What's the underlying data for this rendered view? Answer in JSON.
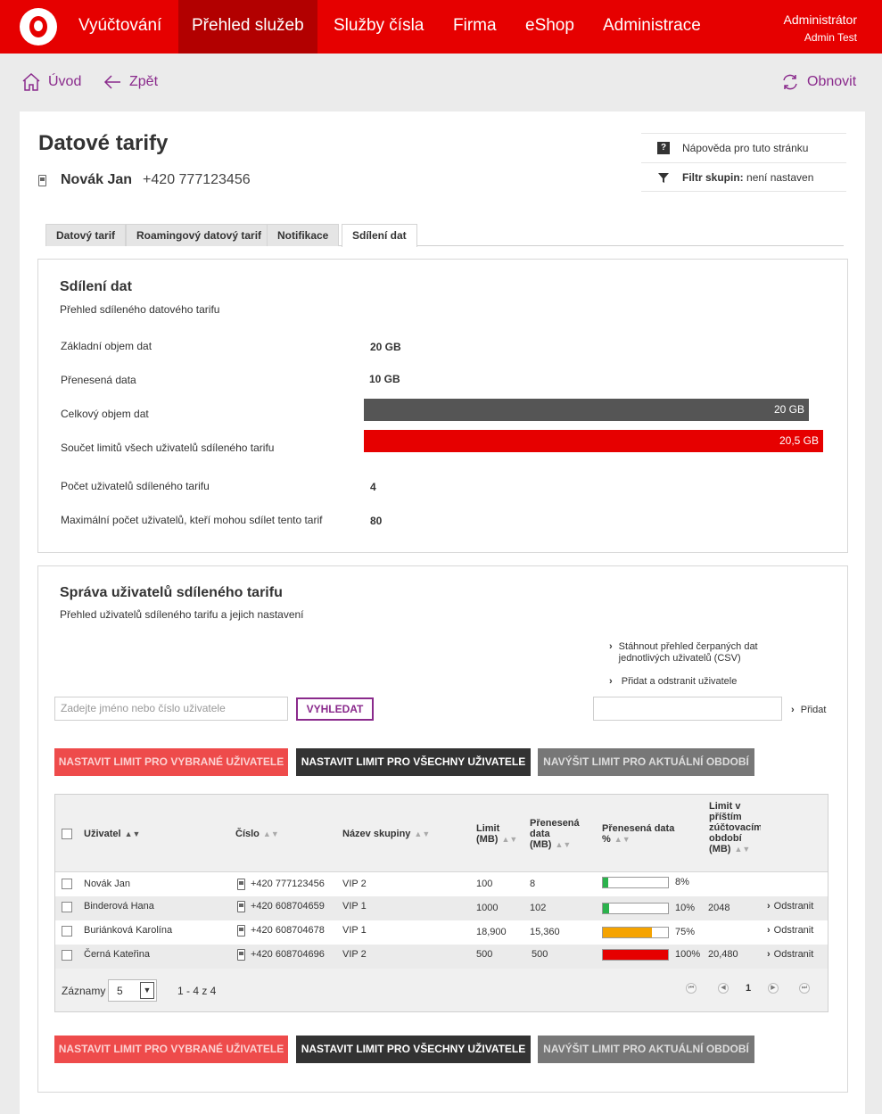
{
  "topnav": {
    "items": [
      "Vyúčtování",
      "Přehled služeb",
      "Služby čísla",
      "Firma",
      "eShop",
      "Administrace"
    ],
    "active_index": 1,
    "user_role": "Administrátor",
    "user_name": "Admin Test"
  },
  "toolbar": {
    "home_label": "Úvod",
    "back_label": "Zpět",
    "refresh_label": "Obnovit"
  },
  "page": {
    "title": "Datové tarify",
    "user_name": "Novák Jan",
    "user_number": "+420 777123456",
    "help_label": "Nápověda pro tuto stránku",
    "filter_label": "Filtr skupin:",
    "filter_value": "není nastaven"
  },
  "tabs": [
    "Datový tarif",
    "Roamingový datový tarif",
    "Notifikace",
    "Sdílení dat"
  ],
  "sharing": {
    "title": "Sdílení dat",
    "subtitle": "Přehled sdíleného datového tarifu",
    "base_label": "Základní objem dat",
    "base_value": "20 GB",
    "transferred_label": "Přenesená data",
    "transferred_value": "10 GB",
    "total_label": "Celkový objem dat",
    "total_value": "20 GB",
    "limits_label": "Součet limitů všech uživatelů sdíleného tarifu",
    "limits_value": "20,5 GB",
    "users_label": "Počet uživatelů sdíleného tarifu",
    "users_value": "4",
    "max_label": "Maximální počet uživatelů, kteří mohou sdílet tento tarif",
    "max_value": "80"
  },
  "users": {
    "title": "Správa uživatelů sdíleného tarifu",
    "subtitle": "Přehled uživatelů sdíleného tarifu a jejich nastavení",
    "download_link": "Stáhnout přehled čerpaných dat jednotlivých uživatelů (CSV)",
    "add_remove_link": "Přidat a odstranit uživatele",
    "search_placeholder": "Zadejte jméno nebo číslo uživatele",
    "search_button": "VYHLEDAT",
    "add_label": "Přidat",
    "btn_set_selected": "NASTAVIT LIMIT PRO VYBRANÉ UŽIVATELE",
    "btn_set_all": "NASTAVIT LIMIT PRO VŠECHNY UŽIVATELE",
    "btn_increase": "NAVÝŠIT LIMIT PRO AKTUÁLNÍ OBDOBÍ",
    "columns": {
      "user": "Uživatel",
      "number": "Číslo",
      "group": "Název skupiny",
      "limit": "Limit (MB)",
      "transferred": "Přenesená data (MB)",
      "transferred_pct": "Přenesená data %",
      "next_limit": "Limit v příštím zúčtovacím období (MB)"
    },
    "rows": [
      {
        "name": "Novák Jan",
        "number": "+420 777123456",
        "group": "VIP 2",
        "limit": "100",
        "transferred": "8",
        "pct": 8,
        "pct_label": "8%",
        "next": "",
        "action": "",
        "bar_color": "#2bb24c"
      },
      {
        "name": "Binderová Hana",
        "number": "+420 608704659",
        "group": "VIP 1",
        "limit": "1000",
        "transferred": "102",
        "pct": 10,
        "pct_label": "10%",
        "next": "2048",
        "action": "Odstranit",
        "bar_color": "#2bb24c"
      },
      {
        "name": "Buriánková Karolína",
        "number": "+420 608704678",
        "group": "VIP 1",
        "limit": "18,900",
        "transferred": "15,360",
        "pct": 75,
        "pct_label": "75%",
        "next": "",
        "action": "Odstranit",
        "bar_color": "#f5a300"
      },
      {
        "name": "Černá Kateřina",
        "number": "+420 608704696",
        "group": "VIP 2",
        "limit": "500",
        "transferred": "500",
        "pct": 100,
        "pct_label": "100%",
        "next": "20,480",
        "action": "Odstranit",
        "bar_color": "#e60000"
      }
    ],
    "records_label": "Záznamy",
    "page_size": "5",
    "range_label": "1 - 4 z 4",
    "current_page": "1"
  },
  "colors": {
    "brand": "#e60000",
    "accent": "#8a2a8c",
    "bar_total": "#555555",
    "bar_limits": "#e60000"
  }
}
